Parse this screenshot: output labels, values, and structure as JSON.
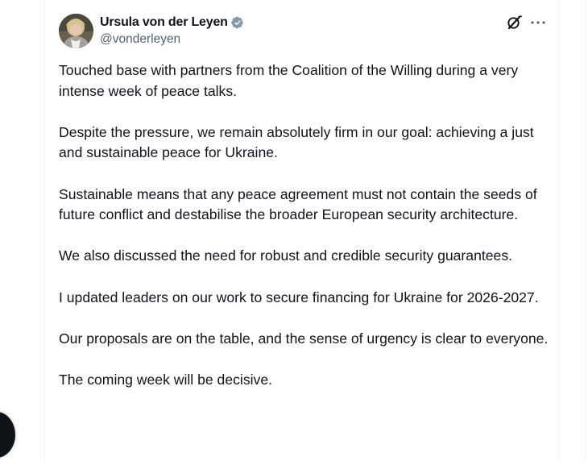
{
  "tweet": {
    "author": {
      "display_name": "Ursula von der Leyen",
      "handle": "@vonderleyen",
      "verified_color": "#829aab"
    },
    "icons": {
      "grok": "grok-icon",
      "more": "more-icon",
      "verified": "verified-badge-icon"
    },
    "paragraphs": [
      "Touched base with partners from the Coalition of the Willing during a very intense week of peace talks.",
      "Despite the pressure, we remain absolutely firm in our goal: achieving a just and sustainable peace for Ukraine.",
      "Sustainable means that any peace agreement must not contain the seeds of future conflict and destabilise the broader European security architecture.",
      "We also discussed the need for robust and credible security guarantees.",
      "I updated leaders on our work to secure financing for Ukraine for 2026-2027.",
      "Our proposals are on the table, and the sense of urgency is clear to everyone.",
      "The coming week will be decisive."
    ]
  },
  "colors": {
    "text": "#0f1419",
    "secondary_text": "#536471",
    "border": "#eff3f4",
    "floating_button": "#0f1419"
  }
}
